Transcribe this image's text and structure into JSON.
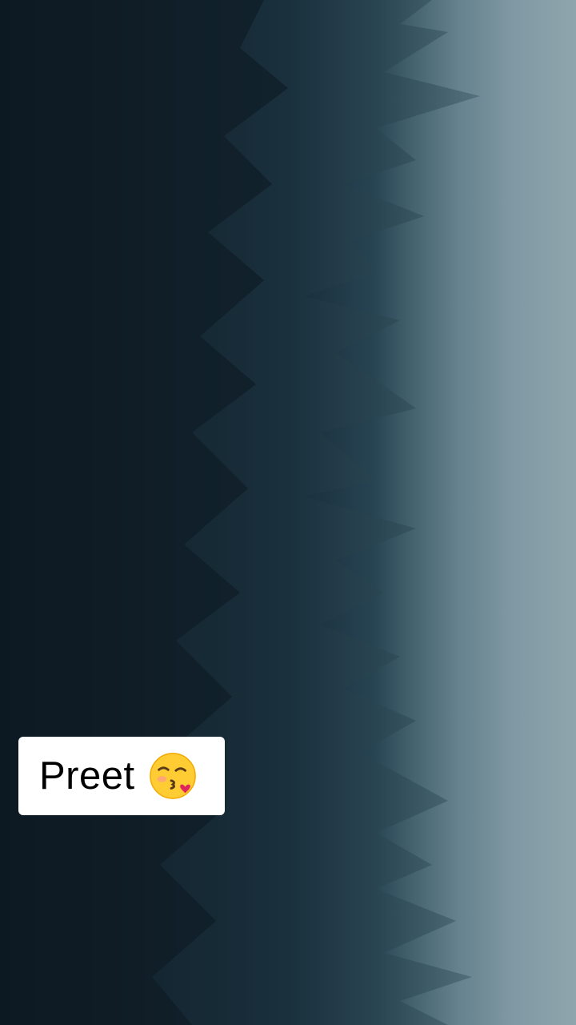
{
  "caption": {
    "text": "Preet",
    "emoji_icon": "kissing-face-with-heart-icon"
  },
  "background": {
    "scene": "foggy-forest-icon",
    "colors": {
      "dark": "#0e1a24",
      "fog": "#8fa5ae"
    }
  }
}
